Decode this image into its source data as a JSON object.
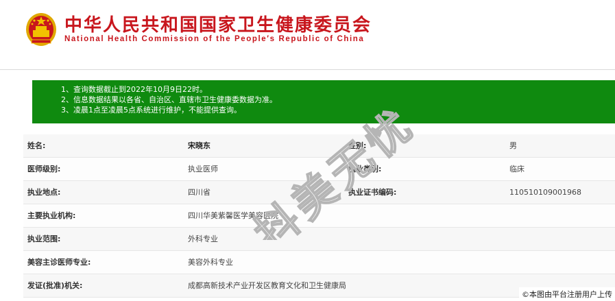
{
  "header": {
    "title_cn": "中华人民共和国国家卫生健康委员会",
    "title_en": "National Health Commission of the People′s Republic of China",
    "emblem_icon": "national-emblem-icon"
  },
  "notice": {
    "lines": [
      "1、查询数据截止到2022年10月9日22时。",
      "2、信息数据结果以各省、自治区、直辖市卫生健康委数据为准。",
      "3、凌晨1点至凌晨5点系统进行维护，不能提供查询。"
    ],
    "bg_color": "#0f8a0f"
  },
  "record": {
    "name_label": "姓名:",
    "name_value": "宋晓东",
    "gender_label": "性别:",
    "gender_value": "男",
    "level_label": "医师级别:",
    "level_value": "执业医师",
    "category_label": "执业类别:",
    "category_value": "临床",
    "location_label": "执业地点:",
    "location_value": "四川省",
    "cert_label": "执业证书编码:",
    "cert_value": "110510109001968",
    "org_label": "主要执业机构:",
    "org_value": "四川华美紫馨医学美容医院",
    "scope_label": "执业范围:",
    "scope_value": "外科专业",
    "specialty_label": "美容主诊医师专业:",
    "specialty_value": "美容外科专业",
    "issuer_label": "发证(批准)机关:",
    "issuer_value": "成都高新技术产业开发区教育文化和卫生健康局"
  },
  "watermark_text": "抖美无忧",
  "credit": "©本图由平台注册用户上传",
  "colors": {
    "brand_red": "#c8161d",
    "emblem_gold": "#f2c200"
  }
}
